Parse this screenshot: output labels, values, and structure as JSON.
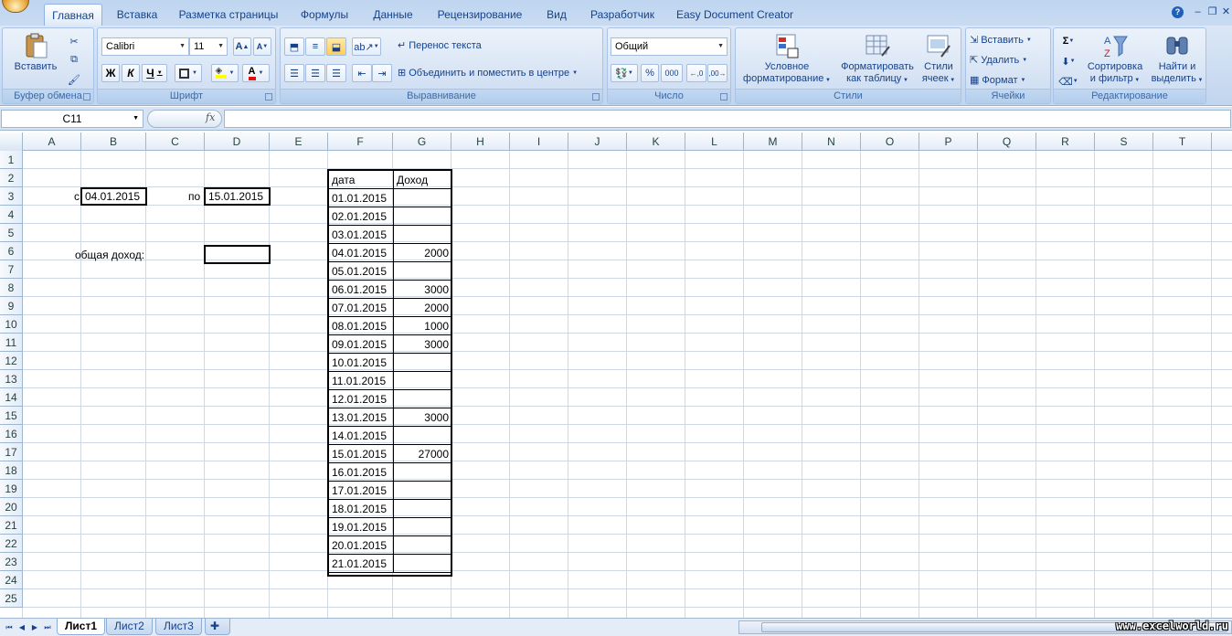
{
  "ribbon_tabs": [
    "Главная",
    "Вставка",
    "Разметка страницы",
    "Формулы",
    "Данные",
    "Рецензирование",
    "Вид",
    "Разработчик",
    "Easy Document Creator"
  ],
  "clipboard": {
    "paste": "Вставить",
    "label": "Буфер обмена"
  },
  "font": {
    "name": "Calibri",
    "size": "11",
    "bold": "Ж",
    "italic": "К",
    "underline": "Ч",
    "label": "Шрифт"
  },
  "alignment": {
    "wrap": "Перенос текста",
    "merge": "Объединить и поместить в центре",
    "label": "Выравнивание"
  },
  "number": {
    "format": "Общий",
    "percent": "%",
    "thousands": "000",
    "label": "Число"
  },
  "styles": {
    "conditional1": "Условное",
    "conditional2": "форматирование",
    "table1": "Форматировать",
    "table2": "как таблицу",
    "cell1": "Стили",
    "cell2": "ячеек",
    "label": "Стили"
  },
  "cells": {
    "insert": "Вставить",
    "delete": "Удалить",
    "format": "Формат",
    "label": "Ячейки"
  },
  "editing": {
    "sort1": "Сортировка",
    "sort2": "и фильтр",
    "find1": "Найти и",
    "find2": "выделить",
    "label": "Редактирование"
  },
  "formula_bar": {
    "name_box": "C11",
    "fx": "fx",
    "content": ""
  },
  "columns": [
    "A",
    "B",
    "C",
    "D",
    "E",
    "F",
    "G",
    "H",
    "I",
    "J",
    "K",
    "L",
    "M",
    "N",
    "O",
    "P",
    "Q",
    "R",
    "S",
    "T"
  ],
  "rows": [
    "1",
    "2",
    "3",
    "4",
    "5",
    "6",
    "7",
    "8",
    "9",
    "10",
    "11",
    "12",
    "13",
    "14",
    "15",
    "16",
    "17",
    "18",
    "19",
    "20",
    "21",
    "22",
    "23",
    "24",
    "25"
  ],
  "cells_data": {
    "c_label": "с",
    "from_date": "04.01.2015",
    "po_label": "по",
    "to_date": "15.01.2015",
    "total_label": "общая доход:",
    "total_value": "",
    "hdr_date": "дата",
    "hdr_income": "Доход"
  },
  "table": [
    {
      "date": "01.01.2015",
      "income": ""
    },
    {
      "date": "02.01.2015",
      "income": ""
    },
    {
      "date": "03.01.2015",
      "income": ""
    },
    {
      "date": "04.01.2015",
      "income": "2000"
    },
    {
      "date": "05.01.2015",
      "income": ""
    },
    {
      "date": "06.01.2015",
      "income": "3000"
    },
    {
      "date": "07.01.2015",
      "income": "2000"
    },
    {
      "date": "08.01.2015",
      "income": "1000"
    },
    {
      "date": "09.01.2015",
      "income": "3000"
    },
    {
      "date": "10.01.2015",
      "income": ""
    },
    {
      "date": "11.01.2015",
      "income": ""
    },
    {
      "date": "12.01.2015",
      "income": ""
    },
    {
      "date": "13.01.2015",
      "income": "3000"
    },
    {
      "date": "14.01.2015",
      "income": ""
    },
    {
      "date": "15.01.2015",
      "income": "27000"
    },
    {
      "date": "16.01.2015",
      "income": ""
    },
    {
      "date": "17.01.2015",
      "income": ""
    },
    {
      "date": "18.01.2015",
      "income": ""
    },
    {
      "date": "19.01.2015",
      "income": ""
    },
    {
      "date": "20.01.2015",
      "income": ""
    },
    {
      "date": "21.01.2015",
      "income": ""
    }
  ],
  "sheets": [
    "Лист1",
    "Лист2",
    "Лист3"
  ],
  "watermark": "www.excelworld.ru",
  "colors": {
    "ribbon_bg": "#c9daf1",
    "grid_line": "#d0d7e5",
    "header_text": "#15428b"
  }
}
